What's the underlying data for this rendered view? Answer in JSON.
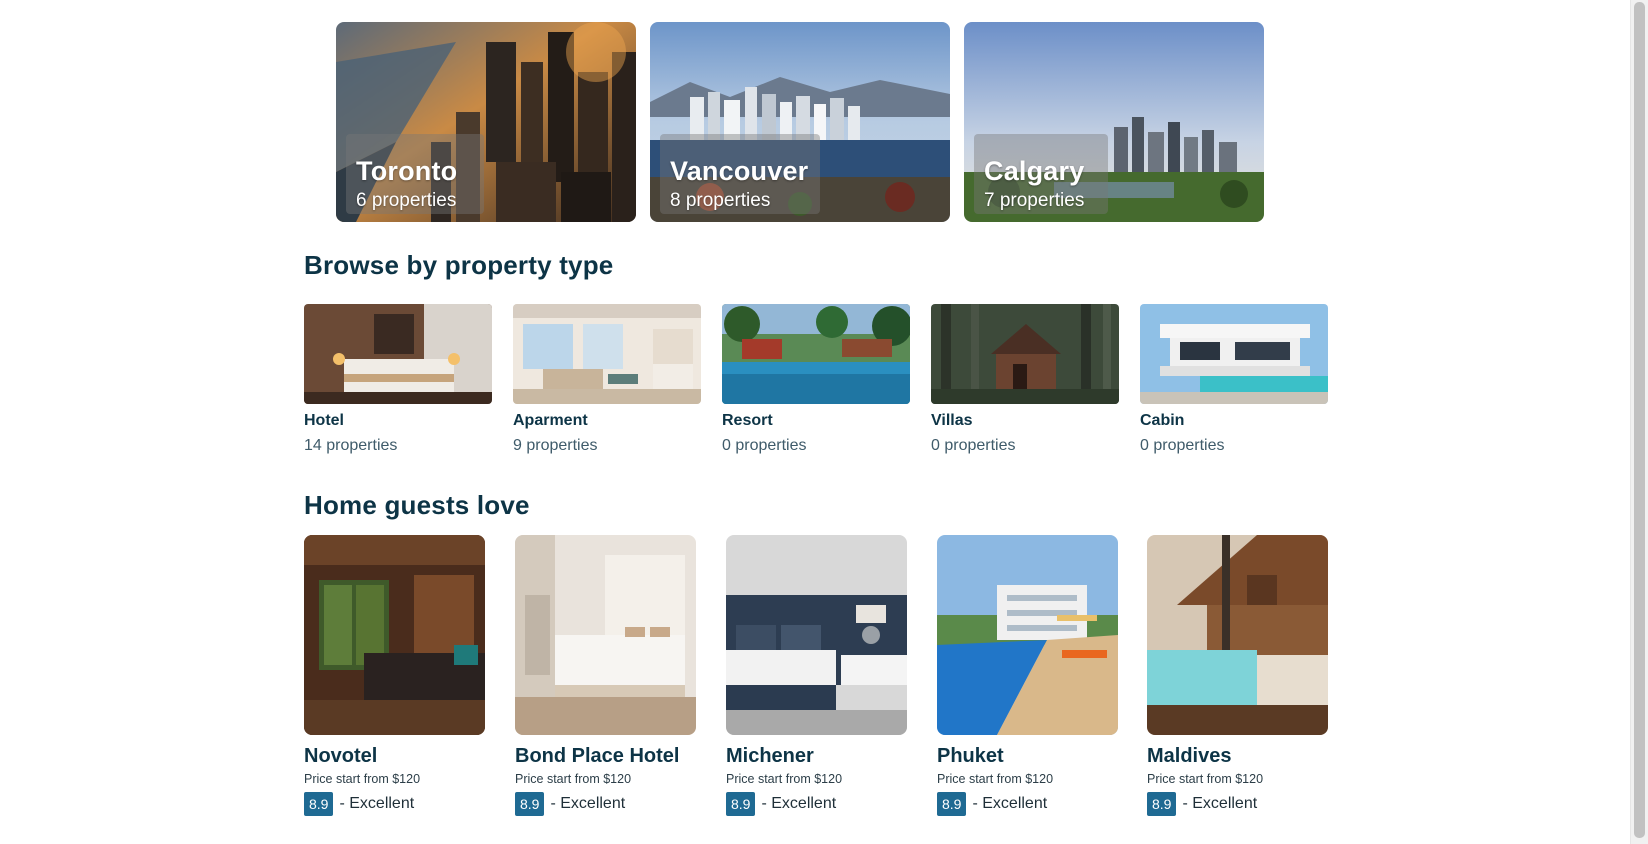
{
  "cities": [
    {
      "name": "Toronto",
      "count": "6 properties"
    },
    {
      "name": "Vancouver",
      "count": "8 properties"
    },
    {
      "name": "Calgary",
      "count": "7 properties"
    }
  ],
  "property_types": {
    "title": "Browse by property type",
    "items": [
      {
        "name": "Hotel",
        "count": "14 properties"
      },
      {
        "name": "Aparment",
        "count": "9 properties"
      },
      {
        "name": "Resort",
        "count": "0 properties"
      },
      {
        "name": "Villas",
        "count": "0 properties"
      },
      {
        "name": "Cabin",
        "count": "0 properties"
      }
    ]
  },
  "homes": {
    "title": "Home guests love",
    "items": [
      {
        "name": "Novotel",
        "price": "Price start from $120",
        "rating": "8.9",
        "rating_label": "- Excellent"
      },
      {
        "name": "Bond Place Hotel",
        "price": "Price start from $120",
        "rating": "8.9",
        "rating_label": "- Excellent"
      },
      {
        "name": "Michener",
        "price": "Price start from $120",
        "rating": "8.9",
        "rating_label": "- Excellent"
      },
      {
        "name": "Phuket",
        "price": "Price start from $120",
        "rating": "8.9",
        "rating_label": "- Excellent"
      },
      {
        "name": "Maldives",
        "price": "Price start from $120",
        "rating": "8.9",
        "rating_label": "- Excellent"
      }
    ]
  },
  "colors": {
    "heading": "#0d3446",
    "rating_badge": "#1f6a93",
    "background": "#ffffff"
  }
}
